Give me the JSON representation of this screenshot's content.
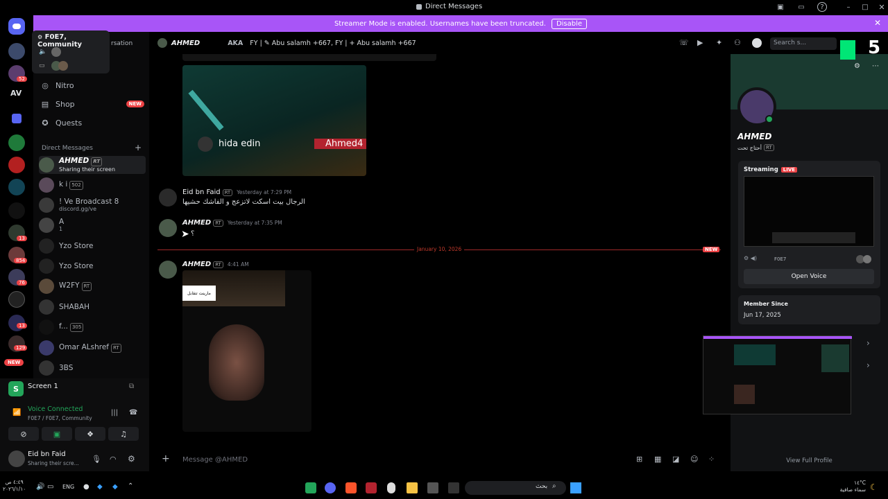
{
  "window": {
    "title": "Direct Messages"
  },
  "banner": {
    "text": "Streamer Mode is enabled. Usernames have been truncated.",
    "disable": "Disable",
    "color": "#a855f7"
  },
  "popup": {
    "title": "F0E7, Community"
  },
  "sidebar": {
    "conversation_snippet": "rsation",
    "nav": [
      {
        "label": "Nitro"
      },
      {
        "label": "Shop",
        "badge": "NEW"
      },
      {
        "label": "Quests"
      }
    ],
    "dm_header": "Direct Messages",
    "dms": [
      {
        "name": "AHMED",
        "tag": "RT",
        "sub": "Sharing their screen"
      },
      {
        "name": "k i",
        "tag": "502",
        "sub": ""
      },
      {
        "name": "! Ve Broadcast 8",
        "sub": "discord.gg/ve"
      },
      {
        "name": "A",
        "sub": "1"
      },
      {
        "name": "Yzo Store",
        "sub": ""
      },
      {
        "name": "Yzo Store",
        "sub": ""
      },
      {
        "name": "W2FY",
        "tag": "RT",
        "sub": ""
      },
      {
        "name": "SHABAH",
        "sub": ""
      },
      {
        "name": "f...",
        "tag": "305",
        "sub": ""
      },
      {
        "name": "Omar ALshref",
        "tag": "RT",
        "sub": ""
      },
      {
        "name": "3BS",
        "sub": ""
      }
    ]
  },
  "rail": {
    "new_label": "NEW",
    "av_label": "AV",
    "badges": [
      "52",
      "13",
      "854",
      "76",
      "13",
      "129"
    ]
  },
  "screen_share": {
    "label": "Screen 1"
  },
  "voice": {
    "status": "Voice Connected",
    "channel": "F0E7 / F0E7, Community"
  },
  "user": {
    "name": "Eid bn Faid",
    "status": "Sharing their scre..."
  },
  "chat_header": {
    "name": "AHMED",
    "aka_label": "AKA",
    "aka_text": "FY | ✎ Abu salamh +667, FY | + Abu salamh +667",
    "search_placeholder": "Search s..."
  },
  "messages": {
    "image_overlay_left": "hida edin",
    "image_overlay_right": "Ahmed4",
    "m1_author": "Eid bn Faid",
    "m1_tag": "RT",
    "m1_time": "Yesterday at 7:29 PM",
    "m1_text": "الرجال بيت  اسكت لاتزعج و الفاشك حشيها",
    "m2_author": "AHMED",
    "m2_tag": "RT",
    "m2_time": "Yesterday at 7:35 PM",
    "m2_text": "؟",
    "divider_date": "January 10, 2026",
    "divider_badge": "NEW",
    "m3_author": "AHMED",
    "m3_tag": "RT",
    "m3_time": "4:41 AM",
    "m3_sticker": "مارينت تتقابل"
  },
  "composer": {
    "placeholder": "Message @AHMED"
  },
  "profile": {
    "name": "AHMED",
    "subline": "أحتاج تحت",
    "tag": "RT",
    "streaming_label": "Streaming",
    "live_label": "LIVE",
    "stream_channel": "F0E7",
    "open_voice": "Open Voice",
    "member_since_label": "Member Since",
    "member_since": "Jun 17, 2025",
    "view_full": "View Full Profile",
    "overlay_number": "5"
  },
  "taskbar": {
    "lang": "ENG",
    "time": "٤:٤٩ ص",
    "date": "٢٠٢٦/١/١٠",
    "weather": "١٤°C",
    "weather_desc": "سماء صافية",
    "search_text": "بحث"
  }
}
